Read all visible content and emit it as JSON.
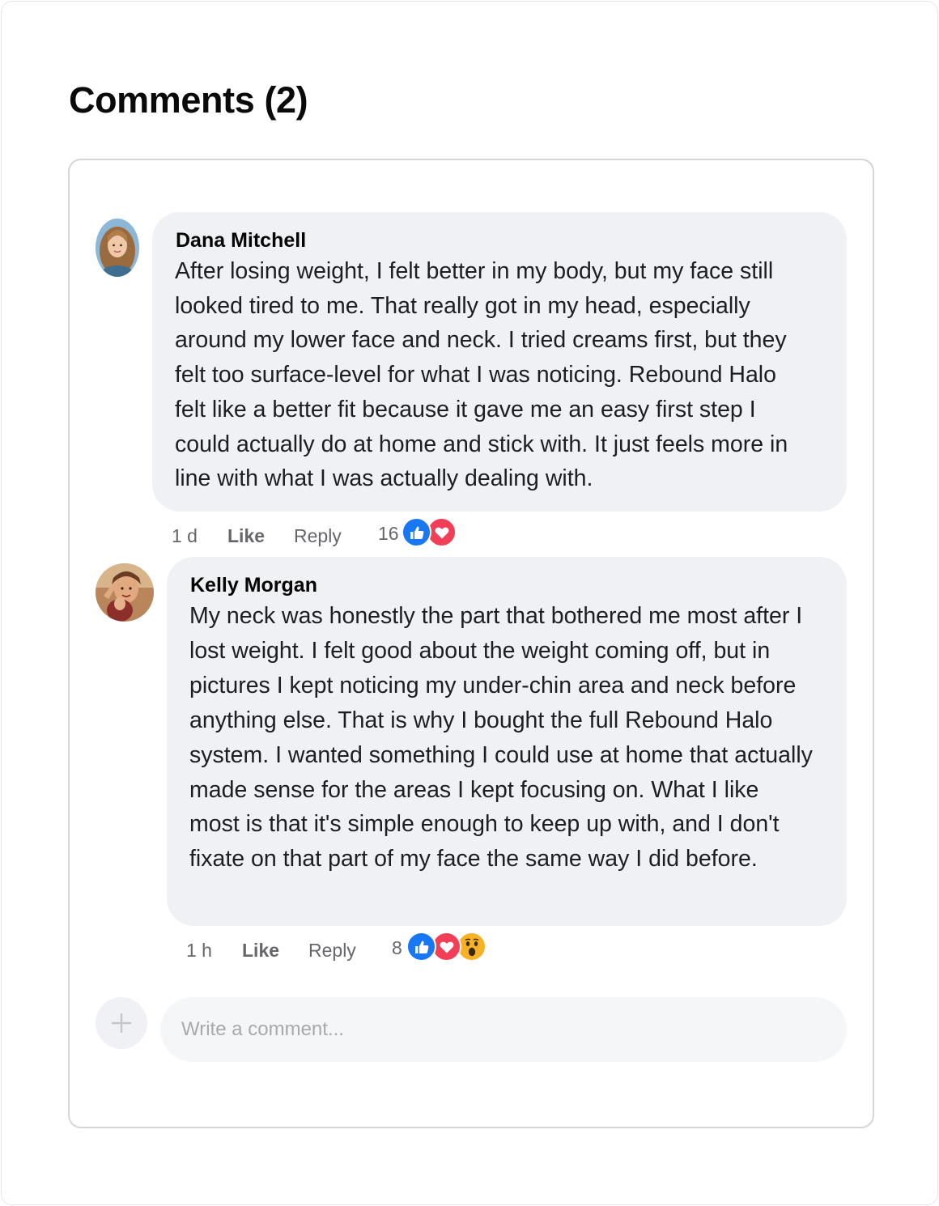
{
  "section_title": "Comments (2)",
  "comments": [
    {
      "author": "Dana Mitchell",
      "lines": [
        "After losing weight, I felt better in my body, but my face still",
        "looked tired to me. That really got in my head, especially",
        "around my lower face and neck. I tried creams first, but they",
        "felt too surface-level for what I was noticing. Rebound Halo",
        "felt like a better fit because it gave me an easy first step I",
        "could actually do at home and stick with. It just feels more in",
        "line with what I was actually dealing with."
      ],
      "time": "1 d",
      "like_label": "Like",
      "reply_label": "Reply",
      "reaction_count": "16",
      "reactions": [
        "like-reaction-icon",
        "love-reaction-icon"
      ]
    },
    {
      "author": "Kelly Morgan",
      "lines": [
        "My neck was honestly the part that bothered me most after I",
        "lost weight. I felt good about the weight coming off, but in",
        "pictures I kept noticing my under-chin area and neck before",
        "anything else. That is why I bought the full Rebound Halo",
        "system. I wanted something I could use at home that actually",
        "made sense for the areas I kept focusing on. What I like",
        "most is that it's simple enough to keep up with, and I don't",
        "fixate on that part of my face the same way I did before."
      ],
      "time": "1 h",
      "like_label": "Like",
      "reply_label": "Reply",
      "reaction_count": "8",
      "reactions": [
        "like-reaction-icon",
        "love-reaction-icon",
        "wow-reaction-icon"
      ]
    }
  ],
  "composer": {
    "placeholder": "Write a comment...",
    "add_icon": "plus-icon"
  },
  "colors": {
    "like_blue": "#1877f2",
    "love_red": "#f33e58",
    "wow_yellow": "#f7b125",
    "bubble_gray": "#f0f1f5"
  }
}
